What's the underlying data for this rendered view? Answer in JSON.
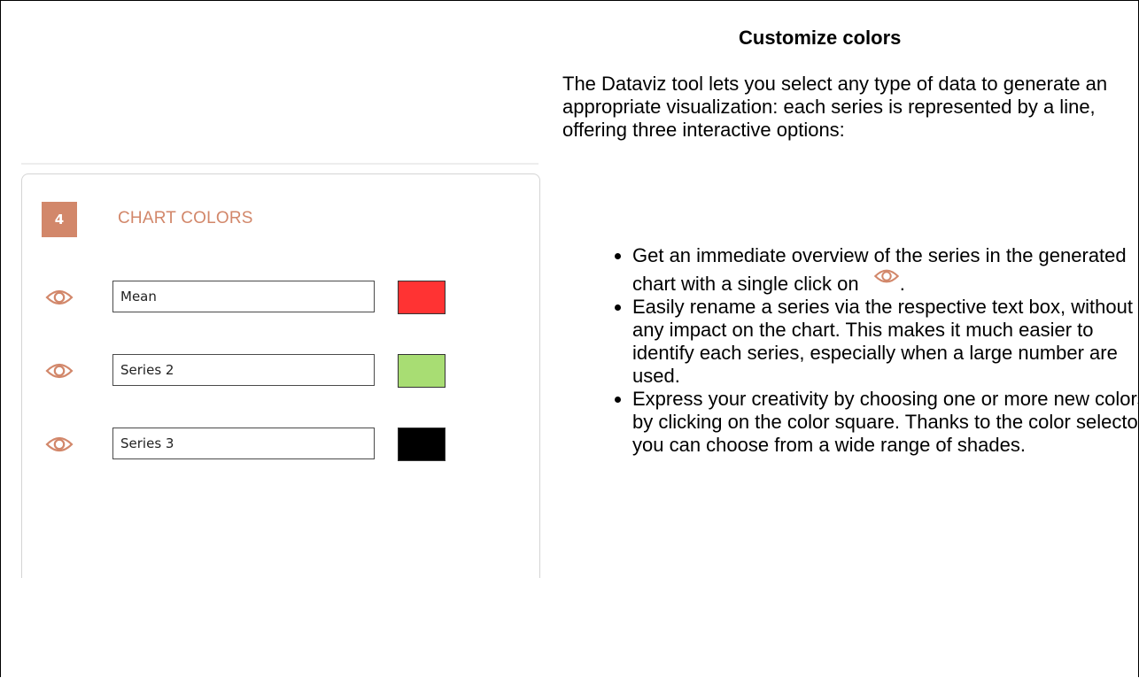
{
  "panel": {
    "step_number": "4",
    "section_title": "CHART COLORS",
    "series": [
      {
        "name": "Mean",
        "color": "#ff3333"
      },
      {
        "name": "Series 2",
        "color": "#a8dd73"
      },
      {
        "name": "Series 3",
        "color": "#000000"
      }
    ],
    "icon": "eye-icon",
    "accent_color": "#d2876a"
  },
  "content": {
    "title": "Customize colors",
    "intro": "The Dataviz tool lets you select any type of data to generate an appropriate visualization: each series is represented by a line, offering three interactive options:",
    "bullet1_before_icon": "Get an immediate overview of the series in the generated chart with a single click on",
    "bullet1_after_icon": ".",
    "bullet2": "Easily rename a series via the respective text box, without any impact on the chart. This makes it much easier to identify each series, especially when a large number are used.",
    "bullet3": "Express your creativity by choosing one or more new colors, by clicking on the color square. Thanks to the color selector, you can choose from a wide range of shades."
  }
}
